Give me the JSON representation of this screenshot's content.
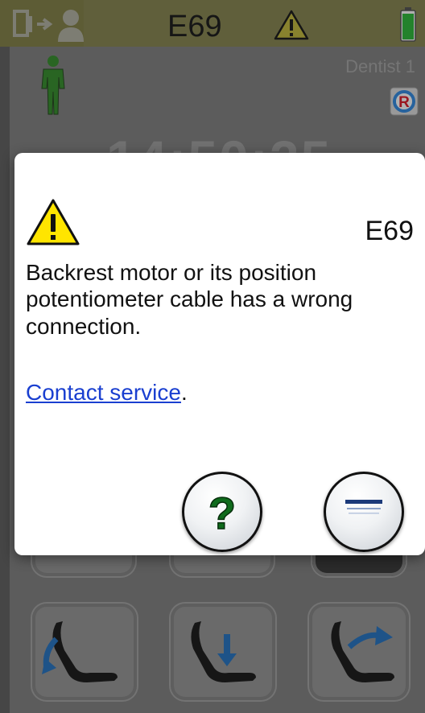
{
  "status_bar": {
    "error_code": "E69",
    "icons": [
      "patient-exit-icon",
      "warning-icon",
      "battery-icon"
    ],
    "battery_color": "#22a02e",
    "bar_color": "#737242"
  },
  "background": {
    "operator_label": "Dentist 1",
    "clock": "14:50:25",
    "icons": [
      "standing-person-icon",
      "return-position-r-icon",
      "chair-backrest-lower-icon",
      "chair-lower-icon",
      "chair-backrest-raise-icon"
    ]
  },
  "dialog": {
    "code": "E69",
    "message": "Backrest motor or its position potentiometer cable has a wrong connection.",
    "link_text": "Contact service",
    "link_suffix": ".",
    "buttons": [
      "help-button",
      "menu-button"
    ]
  },
  "colors": {
    "warning_yellow": "#ffe500",
    "link_blue": "#1a3fd0",
    "arrow_blue": "#1b62a8",
    "help_green": "#0f6b1c"
  }
}
